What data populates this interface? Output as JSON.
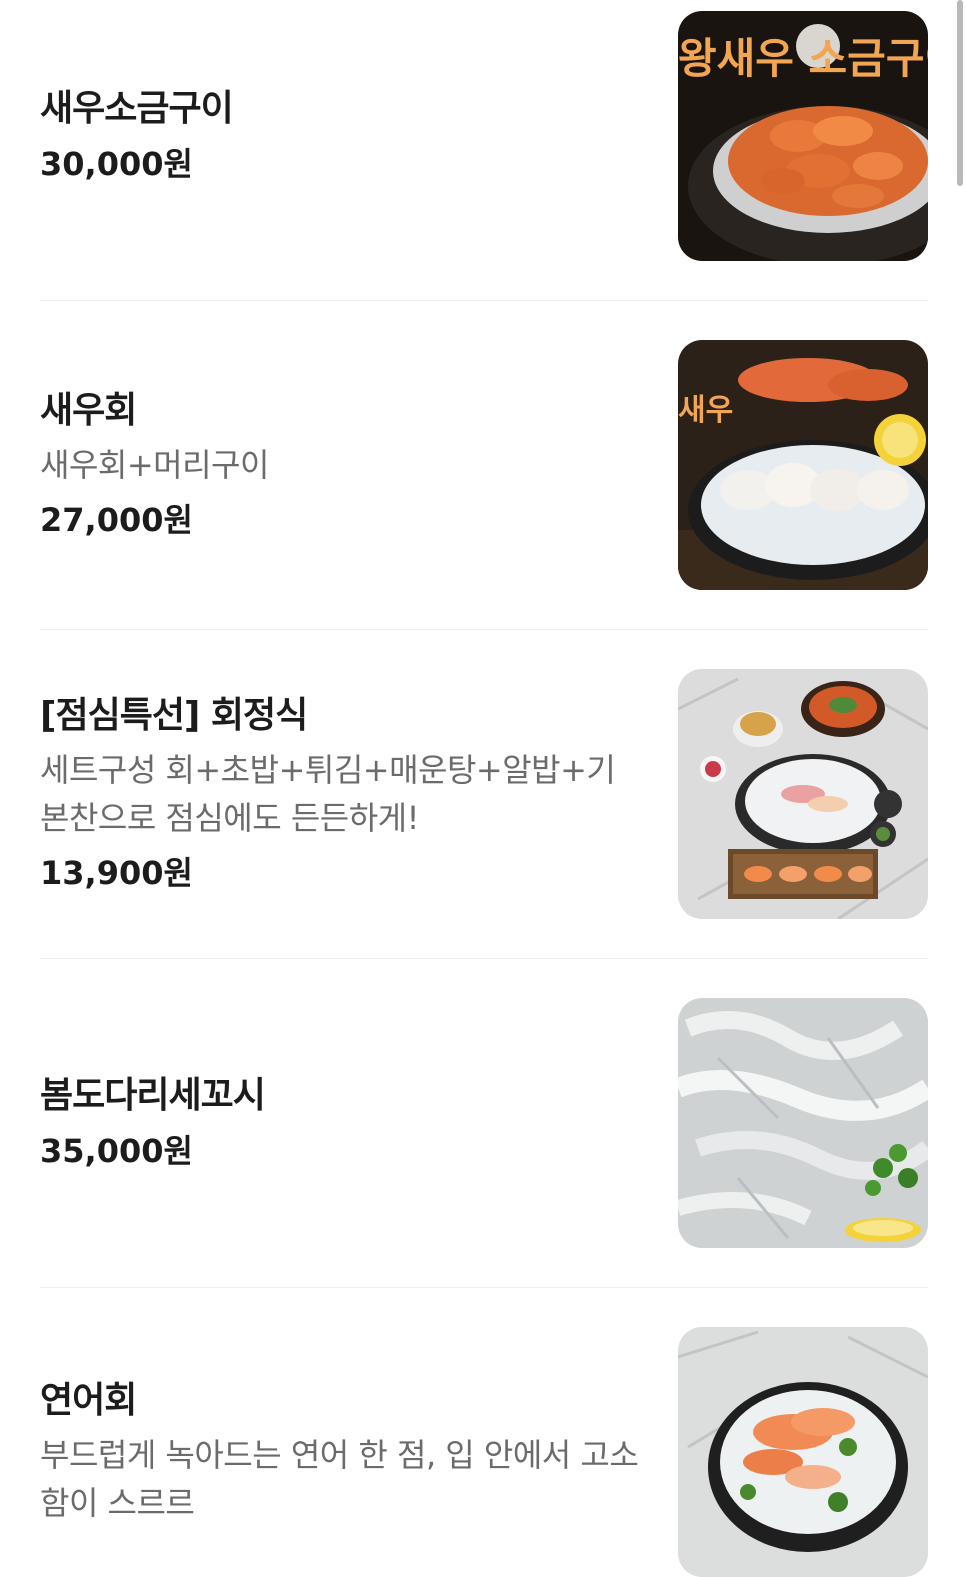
{
  "menu": {
    "items": [
      {
        "name": "새우소금구이",
        "description": "",
        "price": "30,000원",
        "image_icon": "salt-grilled-shrimp-photo",
        "image_caption": "왕새우 소금구이"
      },
      {
        "name": "새우회",
        "description": "새우회+머리구이",
        "price": "27,000원",
        "image_icon": "raw-shrimp-photo",
        "image_caption": "새우"
      },
      {
        "name": "[점심특선] 회정식",
        "description": "세트구성 회+초밥+튀김+매운탕+알밥+기본찬으로 점심에도 든든하게!",
        "price": "13,900원",
        "image_icon": "lunch-set-photo",
        "image_caption": ""
      },
      {
        "name": "봄도다리세꼬시",
        "description": "",
        "price": "35,000원",
        "image_icon": "flounder-sashimi-photo",
        "image_caption": ""
      },
      {
        "name": "연어회",
        "description": "부드럽게 녹아드는 연어 한 점, 입 안에서 고소함이 스르르",
        "price": "",
        "image_icon": "salmon-sashimi-photo",
        "image_caption": ""
      }
    ]
  },
  "colors": {
    "name": "#1c1c1c",
    "description": "#6b6b6b",
    "divider": "#eeeeee"
  }
}
